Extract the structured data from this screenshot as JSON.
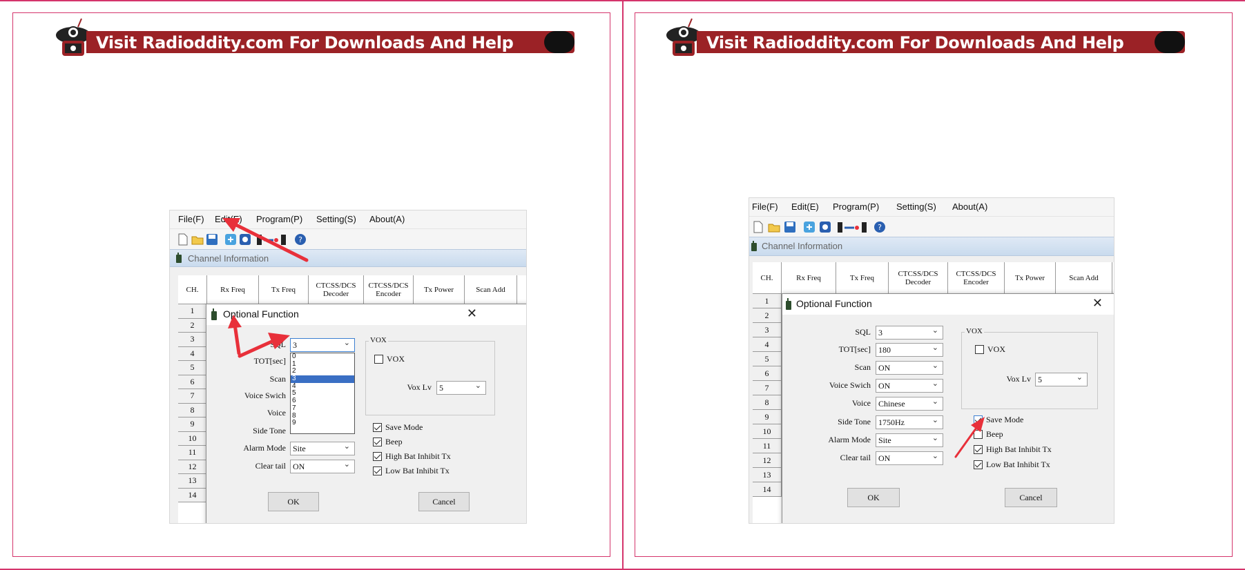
{
  "banner": {
    "text": "Visit Radioddity.com For Downloads And Help"
  },
  "colors": {
    "frame": "#d4336b",
    "banner": "#9b2226",
    "arrow": "#e8303a",
    "selected": "#3a6fc4"
  },
  "app": {
    "menu": [
      "File(F)",
      "Edit(E)",
      "Program(P)",
      "Setting(S)",
      "About(A)"
    ],
    "toolbar_icons": [
      "new-file-icon",
      "open-folder-icon",
      "save-disk-icon",
      "read-radio-icon",
      "write-radio-icon",
      "radio-transfer-icon",
      "help-icon"
    ],
    "panel_title": "Channel Information",
    "columns": [
      "CH.",
      "Rx Freq",
      "Tx Freq",
      "CTCSS/DCS Decoder",
      "CTCSS/DCS Encoder",
      "Tx Power",
      "Scan Add"
    ],
    "rows": [
      "1",
      "2",
      "3",
      "4",
      "5",
      "6",
      "7",
      "8",
      "9",
      "10",
      "11",
      "12",
      "13",
      "14"
    ]
  },
  "dialog": {
    "title": "Optional Function",
    "labels": {
      "sql": "SQL",
      "tot": "TOT[sec]",
      "scan": "Scan",
      "voice_switch": "Voice Swich",
      "voice": "Voice",
      "side_tone": "Side Tone",
      "alarm_mode": "Alarm Mode",
      "clear_tail": "Clear tail"
    },
    "vox_group": "VOX",
    "vox_checkbox": "VOX",
    "vox_level_label": "Vox Lv",
    "checkboxes": [
      "Save Mode",
      "Beep",
      "High Bat Inhibit Tx",
      "Low Bat Inhibit Tx"
    ],
    "ok": "OK",
    "cancel": "Cancel"
  },
  "left": {
    "values": {
      "sql": "3",
      "alarm_mode": "Site",
      "clear_tail": "ON",
      "vox_level": "5"
    },
    "sql_options": [
      "0",
      "1",
      "2",
      "3",
      "4",
      "5",
      "6",
      "7",
      "8",
      "9"
    ],
    "sql_selected_index": 3,
    "vox_checked": false,
    "checked": [
      true,
      true,
      true,
      true
    ]
  },
  "right": {
    "values": {
      "sql": "3",
      "tot": "180",
      "scan": "ON",
      "voice_switch": "ON",
      "voice": "Chinese",
      "side_tone": "1750Hz",
      "alarm_mode": "Site",
      "clear_tail": "ON",
      "vox_level": "5"
    },
    "vox_checked": false,
    "checked": [
      true,
      false,
      true,
      true
    ]
  }
}
